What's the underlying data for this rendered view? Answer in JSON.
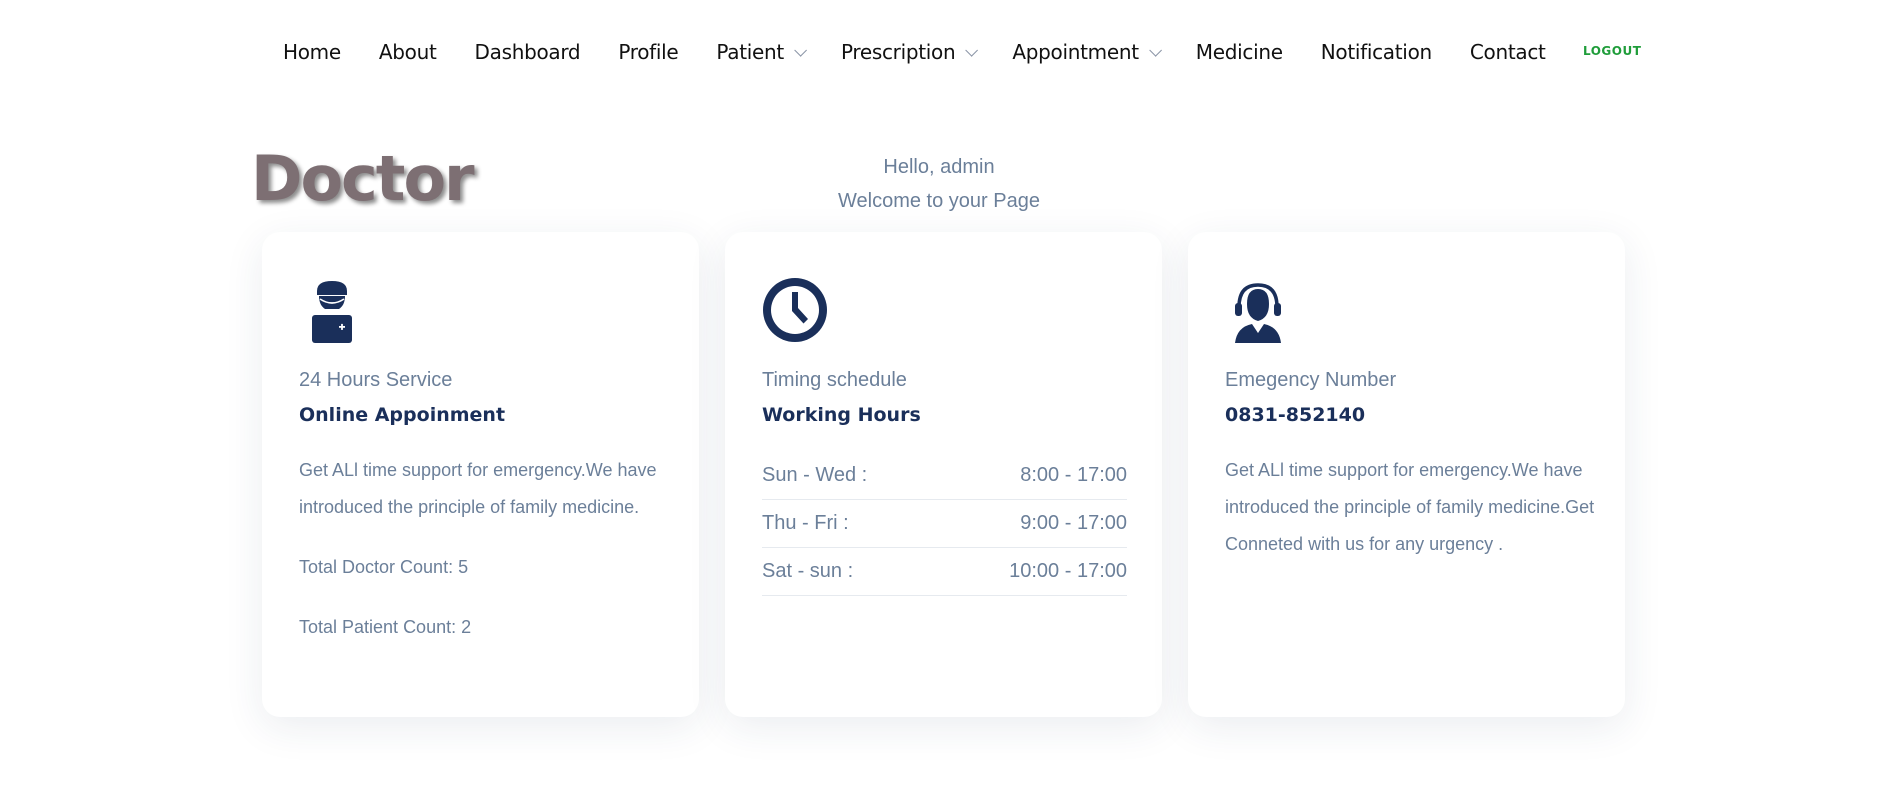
{
  "nav": {
    "items": [
      {
        "label": "Home",
        "dropdown": false
      },
      {
        "label": "About",
        "dropdown": false
      },
      {
        "label": "Dashboard",
        "dropdown": false
      },
      {
        "label": "Profile",
        "dropdown": false
      },
      {
        "label": "Patient",
        "dropdown": true
      },
      {
        "label": "Prescription",
        "dropdown": true
      },
      {
        "label": "Appointment",
        "dropdown": true
      },
      {
        "label": "Medicine",
        "dropdown": false
      },
      {
        "label": "Notification",
        "dropdown": false
      },
      {
        "label": "Contact",
        "dropdown": false
      }
    ],
    "logout_label": "LOGOUT"
  },
  "page": {
    "title": "Doctor",
    "greeting": "Hello, admin",
    "welcome": "Welcome to your Page"
  },
  "colors": {
    "accent_navy": "#1a2f5a",
    "text_muted": "#6b7f99",
    "logout_green": "#1f9d3a",
    "title_brown": "#7d6f73"
  },
  "cards": [
    {
      "icon": "doctor-icon",
      "subtitle": "24 Hours Service",
      "heading": "Online Appoinment",
      "text": "Get ALl time support for emergency.We have introduced the principle of family medicine.",
      "doctor_count": "Total Doctor Count: 5",
      "patient_count": "Total Patient Count: 2"
    },
    {
      "icon": "clock-icon",
      "subtitle": "Timing schedule",
      "heading": "Working Hours",
      "schedule": [
        {
          "day": "Sun - Wed :",
          "time": "8:00 - 17:00"
        },
        {
          "day": "Thu - Fri :",
          "time": "9:00 - 17:00"
        },
        {
          "day": "Sat - sun :",
          "time": "10:00 - 17:00"
        }
      ]
    },
    {
      "icon": "support-headset-icon",
      "subtitle": "Emegency Number",
      "heading": "0831-852140",
      "text": "Get ALl time support for emergency.We have introduced the principle of family medicine.Get Conneted with us for any urgency ."
    }
  ]
}
